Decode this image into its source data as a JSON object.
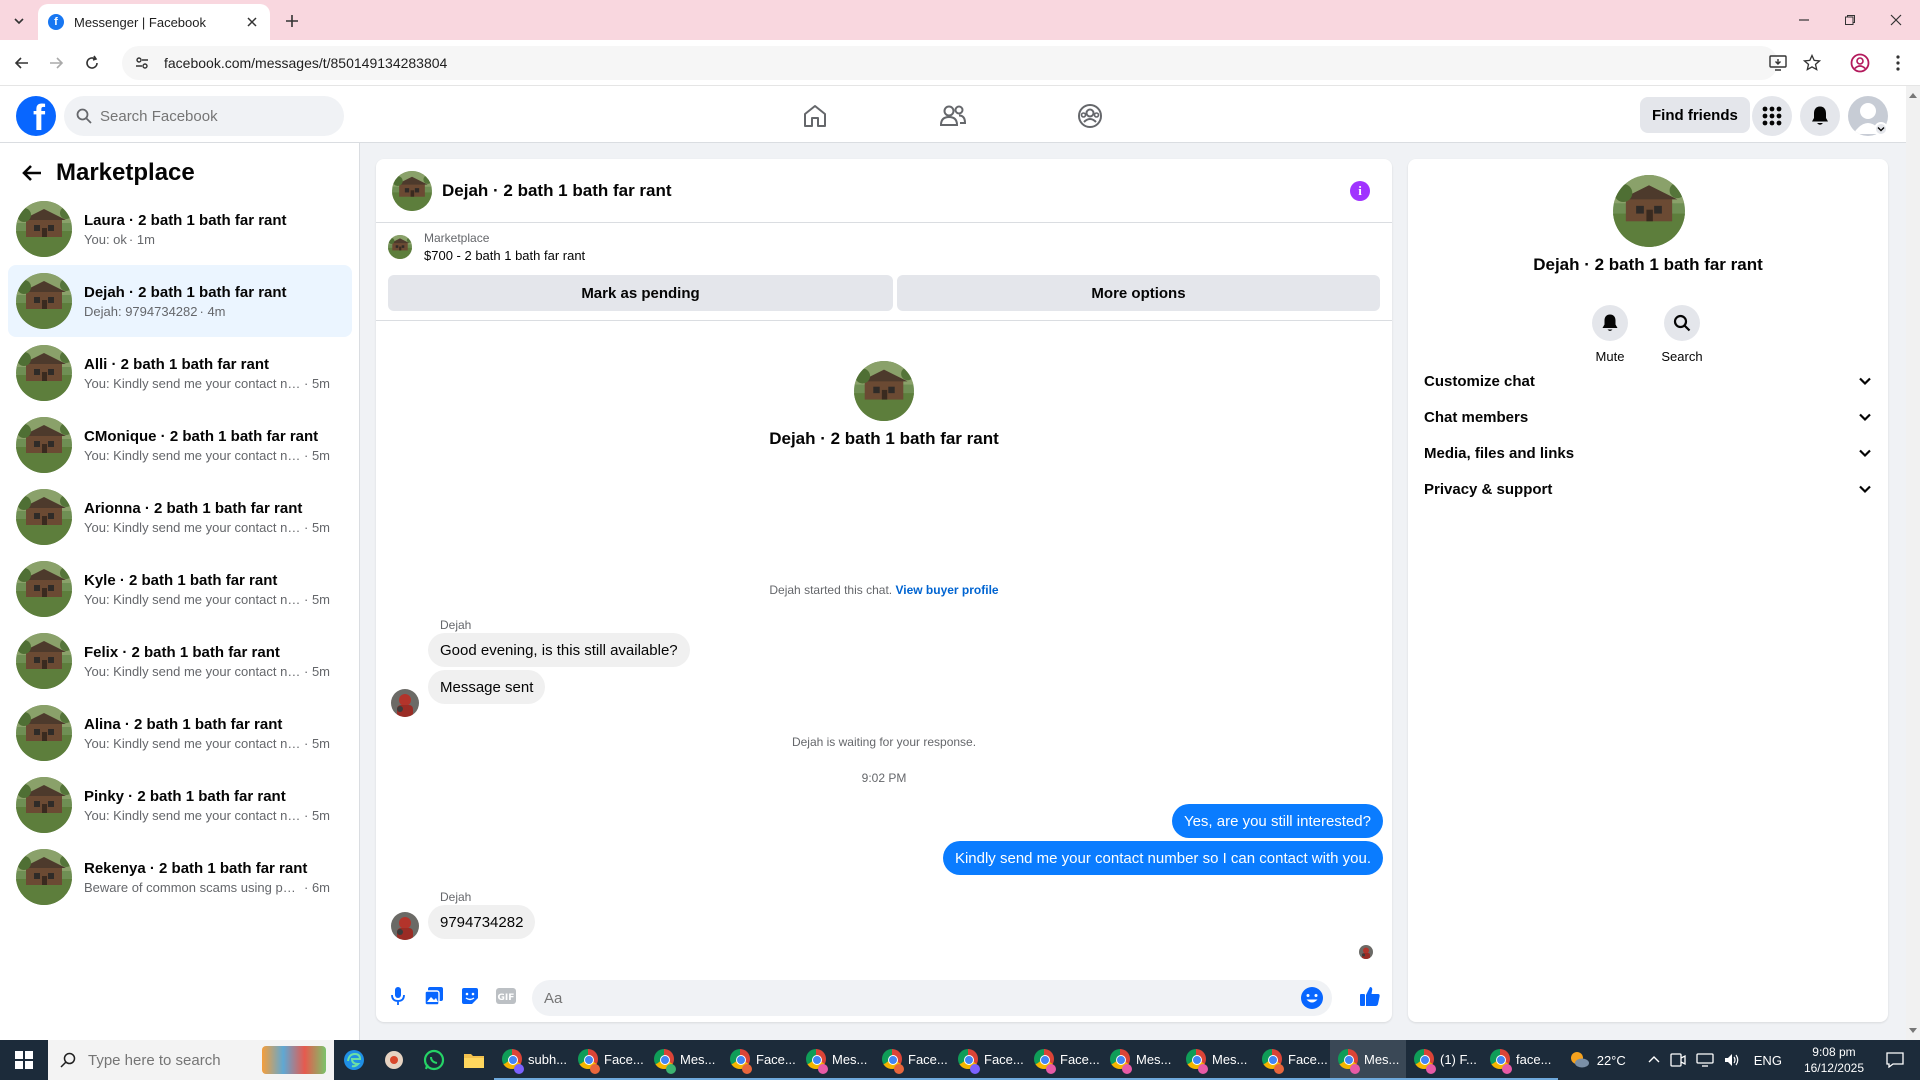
{
  "browser": {
    "tab_title": "Messenger | Facebook",
    "url": "facebook.com/messages/t/850149134283804"
  },
  "header": {
    "search_placeholder": "Search Facebook",
    "find_friends": "Find friends"
  },
  "sidebar": {
    "title": "Marketplace",
    "conversations": [
      {
        "name": "Laura · 2 bath 1 bath far rant",
        "preview": "You: ok",
        "time": "· 1m"
      },
      {
        "name": "Dejah · 2 bath 1 bath far rant",
        "preview": "Dejah: 9794734282",
        "time": "· 4m"
      },
      {
        "name": "Alli · 2 bath 1 bath far rant",
        "preview": "You: Kindly send me your contact nu...",
        "time": "· 5m"
      },
      {
        "name": "CMonique · 2 bath 1 bath far rant",
        "preview": "You: Kindly send me your contact nu...",
        "time": "· 5m"
      },
      {
        "name": "Arionna · 2 bath 1 bath far rant",
        "preview": "You: Kindly send me your contact nu...",
        "time": "· 5m"
      },
      {
        "name": "Kyle · 2 bath 1 bath far rant",
        "preview": "You: Kindly send me your contact nu...",
        "time": "· 5m"
      },
      {
        "name": "Felix · 2 bath 1 bath far rant",
        "preview": "You: Kindly send me your contact nu...",
        "time": "· 5m"
      },
      {
        "name": "Alina · 2 bath 1 bath far rant",
        "preview": "You: Kindly send me your contact nu...",
        "time": "· 5m"
      },
      {
        "name": "Pinky · 2 bath 1 bath far rant",
        "preview": "You: Kindly send me your contact nu...",
        "time": "· 5m"
      },
      {
        "name": "Rekenya · 2 bath 1 bath far rant",
        "preview": "Beware of common scams using pay...",
        "time": "· 6m"
      }
    ]
  },
  "chat": {
    "title": "Dejah · 2 bath 1 bath far rant",
    "listing_source": "Marketplace",
    "listing_title": "$700 - 2 bath 1 bath far rant",
    "mark_pending": "Mark as pending",
    "more_options": "More options",
    "intro_name": "Dejah · 2 bath 1 bath far rant",
    "started_text": "Dejah started this chat.",
    "view_profile": "View buyer profile",
    "sender": "Dejah",
    "msg1": "Good evening, is this still available?",
    "msg2": "Message sent",
    "waiting": "Dejah is waiting for your response.",
    "timestamp": "9:02 PM",
    "out1": "Yes, are you still interested?",
    "out2": "Kindly send me your contact number so I can contact with you.",
    "sender2": "Dejah",
    "msg3": "9794734282",
    "composer_placeholder": "Aa"
  },
  "right_panel": {
    "name": "Dejah · 2 bath 1 bath far rant",
    "mute": "Mute",
    "search": "Search",
    "sections": [
      "Customize chat",
      "Chat members",
      "Media, files and links",
      "Privacy & support"
    ]
  },
  "taskbar": {
    "search_placeholder": "Type here to search",
    "apps": [
      {
        "label": "subh...",
        "dot": "#7b61ff"
      },
      {
        "label": "Face...",
        "dot": "#e8663c"
      },
      {
        "label": "Mes...",
        "dot": "#3cb371"
      },
      {
        "label": "Face...",
        "dot": "#e8663c"
      },
      {
        "label": "Mes...",
        "dot": "#e85aa6"
      },
      {
        "label": "Face...",
        "dot": "#e8663c"
      },
      {
        "label": "Face...",
        "dot": "#7b61ff"
      },
      {
        "label": "Face...",
        "dot": "#e85aa6"
      },
      {
        "label": "Mes...",
        "dot": "#e85aa6"
      },
      {
        "label": "Mes...",
        "dot": "#e85aa6"
      },
      {
        "label": "Face...",
        "dot": "#e8663c"
      },
      {
        "label": "Mes...",
        "dot": "#e85aa6"
      },
      {
        "label": "(1) F...",
        "dot": "#e85aa6"
      },
      {
        "label": "face...",
        "dot": "#e85aa6"
      }
    ],
    "weather": "22°C",
    "language": "ENG",
    "time": "9:08 pm",
    "date": "16/12/2025"
  },
  "colors": {
    "brand": "#0866ff",
    "outgoing_bubble": "#0a7cff",
    "active_conversation": "#ebf5ff",
    "tab_strip": "#f9d7df"
  }
}
